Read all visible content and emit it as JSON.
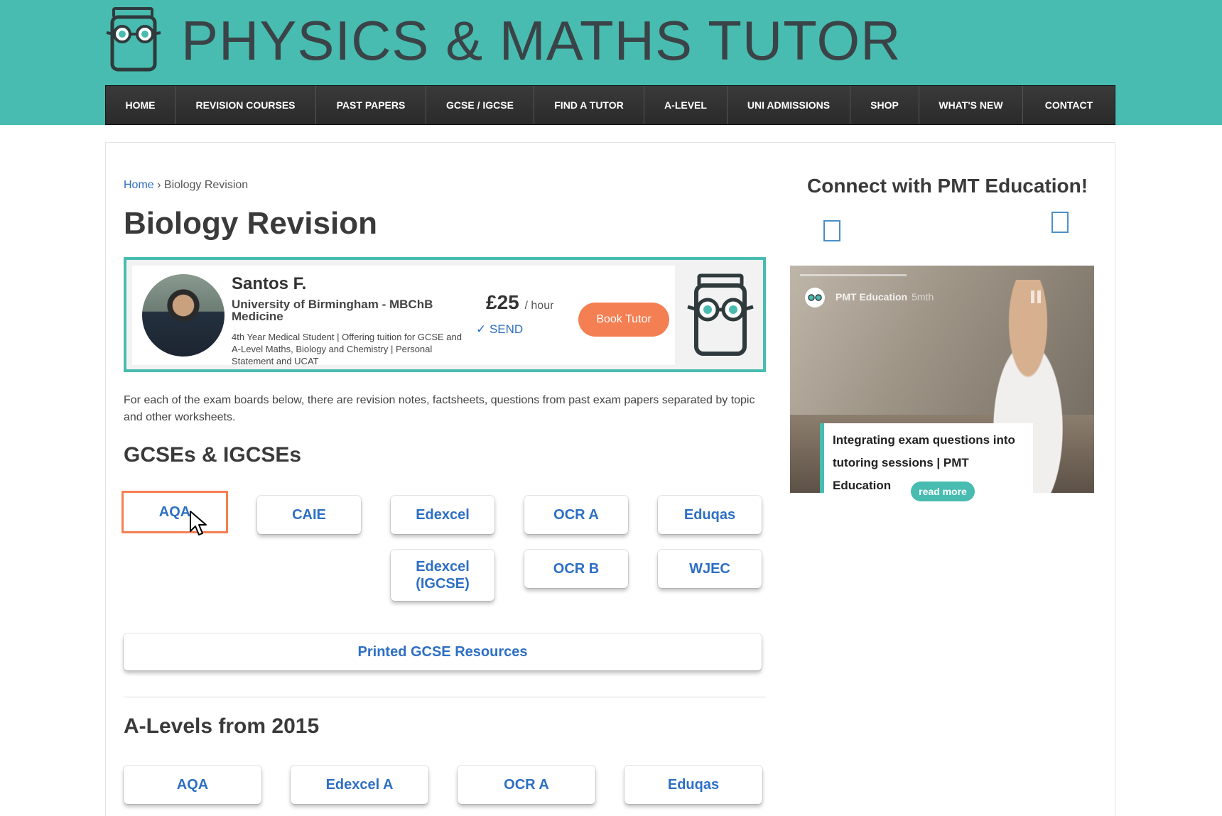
{
  "header": {
    "site_title": "PHYSICS & MATHS TUTOR"
  },
  "nav": {
    "items": [
      {
        "label": "HOME"
      },
      {
        "label": "REVISION COURSES"
      },
      {
        "label": "PAST PAPERS"
      },
      {
        "label": "GCSE / IGCSE"
      },
      {
        "label": "FIND A TUTOR"
      },
      {
        "label": "A-LEVEL"
      },
      {
        "label": "UNI ADMISSIONS"
      },
      {
        "label": "SHOP"
      },
      {
        "label": "WHAT'S NEW"
      },
      {
        "label": "CONTACT"
      }
    ]
  },
  "breadcrumb": {
    "home": "Home",
    "separator": "›",
    "current": "Biology Revision"
  },
  "page_title": "Biology Revision",
  "tutor": {
    "name": "Santos F.",
    "university": "University of Birmingham - MBChB Medicine",
    "description": "4th Year Medical Student | Offering tuition for GCSE and A-Level Maths, Biology and Chemistry | Personal Statement and UCAT",
    "price": "£25",
    "price_unit": "/ hour",
    "send": "✓ SEND",
    "book_label": "Book Tutor"
  },
  "intro_text": "For each of the exam boards below, there are revision notes, factsheets, questions from past exam papers separated by topic and other worksheets.",
  "gcse": {
    "heading": "GCSEs & IGCSEs",
    "boards": [
      "AQA",
      "CAIE",
      "Edexcel",
      "OCR A",
      "Eduqas",
      "Edexcel (IGCSE)",
      "OCR B",
      "WJEC"
    ],
    "printed": "Printed GCSE Resources"
  },
  "alevel": {
    "heading": "A-Levels from 2015",
    "boards": [
      "AQA",
      "Edexcel A",
      "OCR A",
      "Eduqas"
    ]
  },
  "sidebar": {
    "heading": "Connect with PMT Education!",
    "video": {
      "channel": "PMT Education",
      "age": "5mth",
      "caption_line1": "Integrating exam questions into",
      "caption_line2": "tutoring sessions | PMT Education",
      "read_more": "read more"
    }
  },
  "colors": {
    "brand_teal": "#48bcb0",
    "accent_orange": "#f47f52",
    "link_blue": "#2d6fc4"
  }
}
